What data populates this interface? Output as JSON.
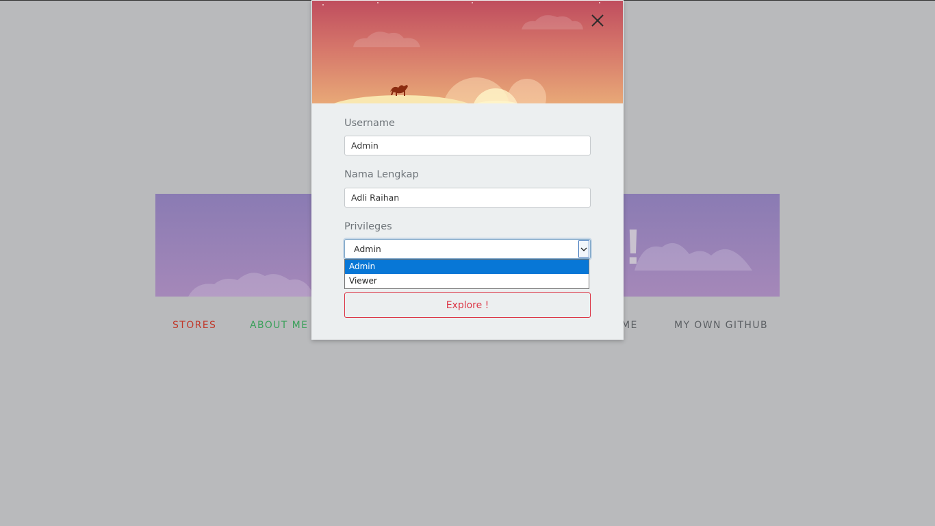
{
  "background_page": {
    "hero_exclaim": "!",
    "nav": {
      "links": [
        {
          "label": "STORES",
          "color": "#c0392b"
        },
        {
          "label": "ABOUT ME",
          "color": "#3aa05a"
        },
        {
          "label": "ME",
          "color": "#5b5f63"
        },
        {
          "label": "MY OWN GITHUB",
          "color": "#5b5f63"
        }
      ]
    }
  },
  "modal": {
    "close_icon": "close-x",
    "fields": {
      "username": {
        "label": "Username",
        "value": "Admin"
      },
      "full_name": {
        "label": "Nama Lengkap",
        "value": "Adli Raihan"
      },
      "privileges": {
        "label": "Privileges",
        "selected": "Admin",
        "options": [
          "Admin",
          "Viewer"
        ],
        "highlighted_index": 0
      }
    },
    "submit_label": "Explore !"
  },
  "colors": {
    "page_bg": "#b9babc",
    "modal_bg": "#eceff0",
    "accent_red": "#dc3545",
    "option_highlight": "#0877d6"
  }
}
